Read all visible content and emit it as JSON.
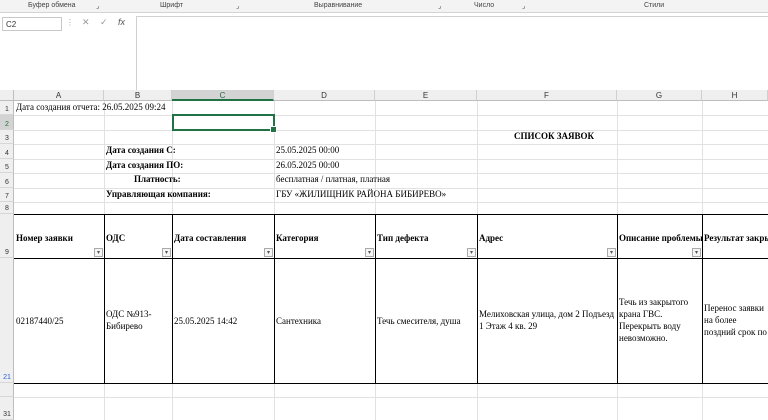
{
  "ribbon": {
    "groups": [
      "Буфер обмена",
      "Шрифт",
      "Выравнивание",
      "Число",
      "Стили"
    ]
  },
  "formula_bar": {
    "name_box": "C2",
    "cancel_icon": "✕",
    "enter_icon": "✓",
    "fx_icon": "fx",
    "formula": ""
  },
  "columns": [
    "A",
    "B",
    "C",
    "D",
    "E",
    "F",
    "G",
    "H"
  ],
  "selected_column": "C",
  "rows": [
    "1",
    "2",
    "3",
    "4",
    "5",
    "6",
    "7",
    "8",
    "9",
    "21",
    "31"
  ],
  "selected_row": "2",
  "sheet": {
    "created": "Дата создания отчета: 26.05.2025 09:24",
    "title": "СПИСОК ЗАЯВОК",
    "date_from_label": "Дата создания С:",
    "date_from_value": "25.05.2025 00:00",
    "date_to_label": "Дата создания ПО:",
    "date_to_value": "26.05.2025 00:00",
    "paid_label": "Платность:",
    "paid_value": "бесплатная / платная, платная",
    "company_label": "Управляющая компания:",
    "company_value": "ГБУ «ЖИЛИЩНИК РАЙОНА БИБИРЕВО»"
  },
  "table": {
    "headers": [
      "Номер заявки",
      "ОДС",
      "Дата составления",
      "Категория",
      "Тип дефекта",
      "Адрес",
      "Описание проблемы",
      "Результат закры"
    ],
    "row": [
      "02187440/25",
      "ОДС №913-Бибирево",
      "25.05.2025 14:42",
      "Сантехника",
      "Течь смесителя, душа",
      "Мелиховская улица, дом 2 Подъезд 1 Этаж 4 кв. 29",
      "Течь из закрытого крана ГВС. Перекрыть воду невозможно.",
      "Перенос заявки на более поздний срок по инициативе заяви"
    ]
  }
}
